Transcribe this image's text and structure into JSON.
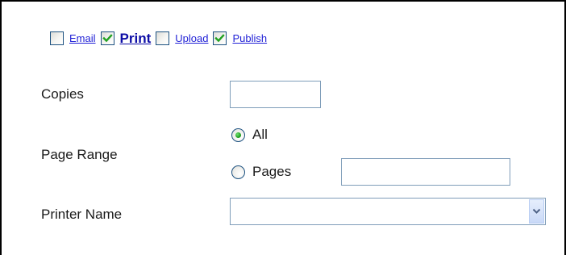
{
  "tabs": [
    {
      "label": "Email",
      "checked": false,
      "active": false
    },
    {
      "label": "Print",
      "checked": true,
      "active": true
    },
    {
      "label": "Upload",
      "checked": false,
      "active": false
    },
    {
      "label": "Publish",
      "checked": true,
      "active": false
    }
  ],
  "copies": {
    "label": "Copies",
    "value": ""
  },
  "page_range": {
    "label": "Page Range",
    "options": [
      {
        "label": "All",
        "selected": true
      },
      {
        "label": "Pages",
        "selected": false
      }
    ],
    "pages_value": ""
  },
  "printer": {
    "label": "Printer Name",
    "selected": ""
  },
  "colors": {
    "link": "#1f1fd6",
    "active_link": "#0d0da6",
    "check": "#21a121",
    "control_border": "#7f9db9"
  }
}
